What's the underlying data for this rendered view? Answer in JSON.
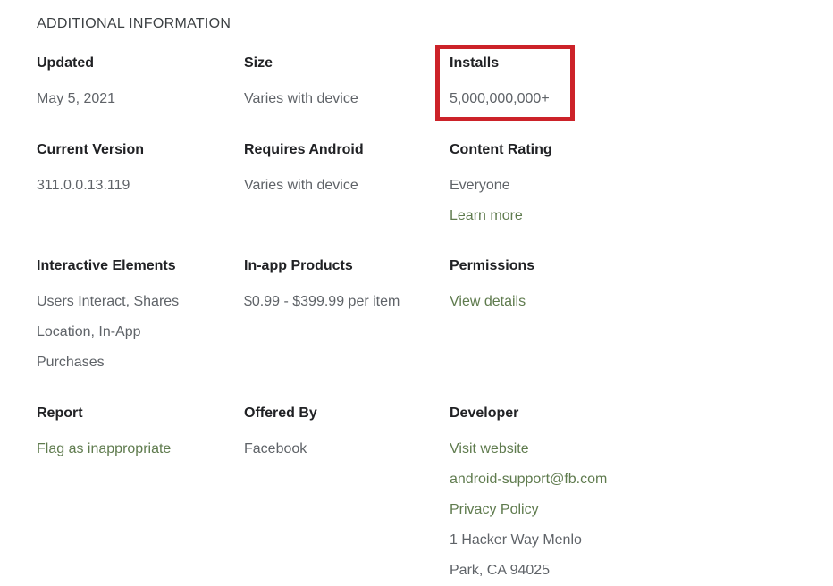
{
  "section": {
    "title": "ADDITIONAL INFORMATION"
  },
  "colors": {
    "link_green": "#5f7b4e",
    "label_dark": "#202124",
    "value_gray": "#5f6368",
    "highlight_red": "#cc2229"
  },
  "fields": {
    "updated": {
      "label": "Updated",
      "value": "May 5, 2021"
    },
    "size": {
      "label": "Size",
      "value": "Varies with device"
    },
    "installs": {
      "label": "Installs",
      "value": "5,000,000,000+"
    },
    "current_version": {
      "label": "Current Version",
      "value": "311.0.0.13.119"
    },
    "requires_android": {
      "label": "Requires Android",
      "value": "Varies with device"
    },
    "content_rating": {
      "label": "Content Rating",
      "value": "Everyone",
      "link": "Learn more"
    },
    "interactive_elements": {
      "label": "Interactive Elements",
      "value": "Users Interact, Shares Location, In-App Purchases"
    },
    "in_app_products": {
      "label": "In-app Products",
      "value": "$0.99 - $399.99 per item"
    },
    "permissions": {
      "label": "Permissions",
      "link": "View details"
    },
    "report": {
      "label": "Report",
      "link": "Flag as inappropriate"
    },
    "offered_by": {
      "label": "Offered By",
      "value": "Facebook"
    },
    "developer": {
      "label": "Developer",
      "website_link": "Visit website",
      "email_link": "android-support@fb.com",
      "privacy_link": "Privacy Policy",
      "address_line1": "1 Hacker Way Menlo",
      "address_line2": "Park, CA 94025"
    }
  },
  "annotation": {
    "highlight_target": "installs"
  }
}
